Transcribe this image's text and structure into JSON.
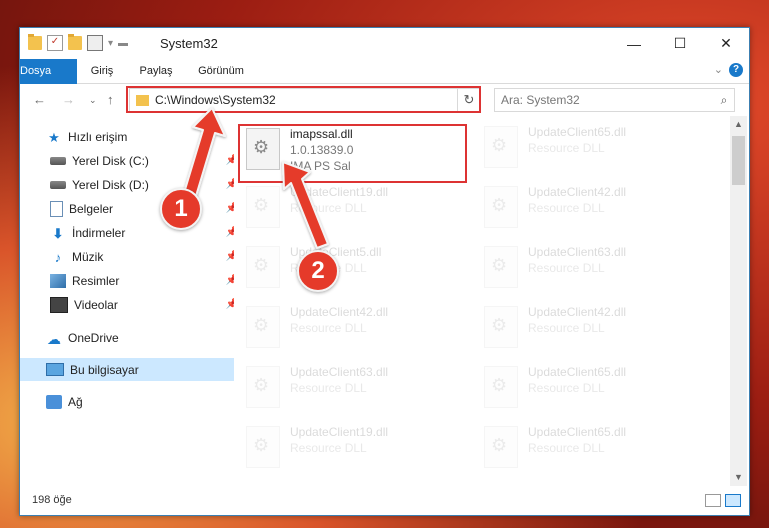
{
  "window": {
    "title": "System32"
  },
  "ribbon": {
    "tabs": [
      "Dosya",
      "Giriş",
      "Paylaş",
      "Görünüm"
    ]
  },
  "address": {
    "path": "C:\\Windows\\System32",
    "search_placeholder": "Ara: System32"
  },
  "nav": {
    "items": [
      {
        "label": "Hızlı erişim",
        "icon": "star-icon",
        "pinned": false
      },
      {
        "label": "Yerel Disk (C:)",
        "icon": "drive-icon",
        "pinned": true
      },
      {
        "label": "Yerel Disk (D:)",
        "icon": "drive-icon",
        "pinned": true
      },
      {
        "label": "Belgeler",
        "icon": "documents-icon",
        "pinned": true
      },
      {
        "label": "İndirmeler",
        "icon": "downloads-icon",
        "pinned": true
      },
      {
        "label": "Müzik",
        "icon": "music-icon",
        "pinned": true
      },
      {
        "label": "Resimler",
        "icon": "pictures-icon",
        "pinned": true
      },
      {
        "label": "Videolar",
        "icon": "videos-icon",
        "pinned": true
      },
      {
        "label": "OneDrive",
        "icon": "onedrive-icon",
        "pinned": false
      },
      {
        "label": "Bu bilgisayar",
        "icon": "this-pc-icon",
        "pinned": false,
        "selected": true
      },
      {
        "label": "Ağ",
        "icon": "network-icon",
        "pinned": false
      }
    ]
  },
  "files": {
    "highlighted": {
      "name": "imapssal.dll",
      "line2": "1.0.13839.0",
      "line3": "IMA PS Sal"
    },
    "left_column": [
      {
        "name": "UpdateClient19.dll",
        "type": "Resource DLL"
      },
      {
        "name": "UpdateClient5.dll",
        "type": "Resource DLL"
      },
      {
        "name": "UpdateClient42.dll",
        "type": "Resource DLL"
      },
      {
        "name": "UpdateClient63.dll",
        "type": "Resource DLL"
      },
      {
        "name": "UpdateClient19.dll",
        "type": "Resource DLL"
      }
    ],
    "right_column": [
      {
        "name": "UpdateClient65.dll",
        "type": "Resource DLL"
      },
      {
        "name": "UpdateClient42.dll",
        "type": "Resource DLL"
      },
      {
        "name": "UpdateClient63.dll",
        "type": "Resource DLL"
      },
      {
        "name": "UpdateClient42.dll",
        "type": "Resource DLL"
      },
      {
        "name": "UpdateClient65.dll",
        "type": "Resource DLL"
      },
      {
        "name": "UpdateClient65.dll",
        "type": "Resource DLL"
      }
    ]
  },
  "status": {
    "count": "198 öğe"
  },
  "callouts": {
    "one": "1",
    "two": "2"
  },
  "colors": {
    "accent": "#1979ca",
    "highlight": "#d33333",
    "selection": "#cce8ff",
    "badge": "#e53a2a"
  }
}
